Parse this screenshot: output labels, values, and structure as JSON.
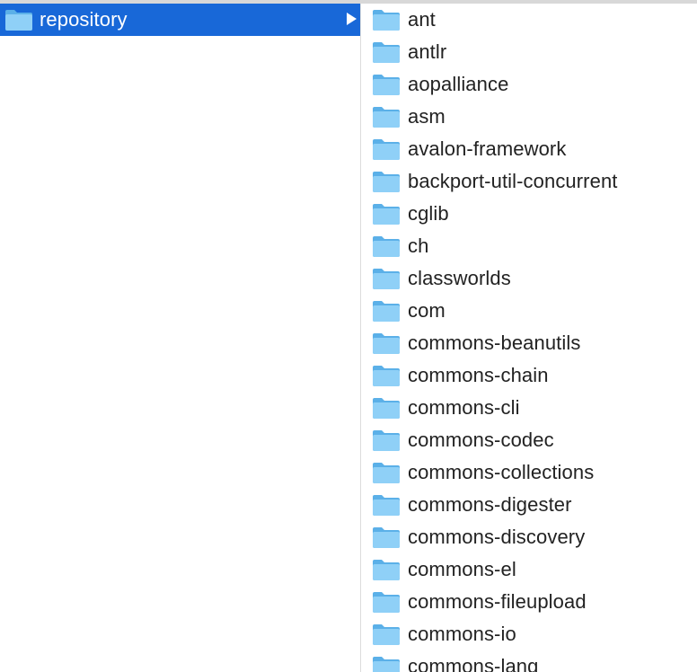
{
  "colors": {
    "selection": "#1868d8",
    "folder_front": "#72c3f3",
    "folder_back": "#5bb0e8",
    "text": "#222222"
  },
  "left_column": {
    "selected_item": {
      "label": "repository",
      "icon": "folder-icon",
      "has_children_indicator": "chevron-right-icon"
    }
  },
  "right_column": {
    "items": [
      {
        "label": "ant"
      },
      {
        "label": "antlr"
      },
      {
        "label": "aopalliance"
      },
      {
        "label": "asm"
      },
      {
        "label": "avalon-framework"
      },
      {
        "label": "backport-util-concurrent"
      },
      {
        "label": "cglib"
      },
      {
        "label": "ch"
      },
      {
        "label": "classworlds"
      },
      {
        "label": "com"
      },
      {
        "label": "commons-beanutils"
      },
      {
        "label": "commons-chain"
      },
      {
        "label": "commons-cli"
      },
      {
        "label": "commons-codec"
      },
      {
        "label": "commons-collections"
      },
      {
        "label": "commons-digester"
      },
      {
        "label": "commons-discovery"
      },
      {
        "label": "commons-el"
      },
      {
        "label": "commons-fileupload"
      },
      {
        "label": "commons-io"
      },
      {
        "label": "commons-lang"
      }
    ]
  }
}
